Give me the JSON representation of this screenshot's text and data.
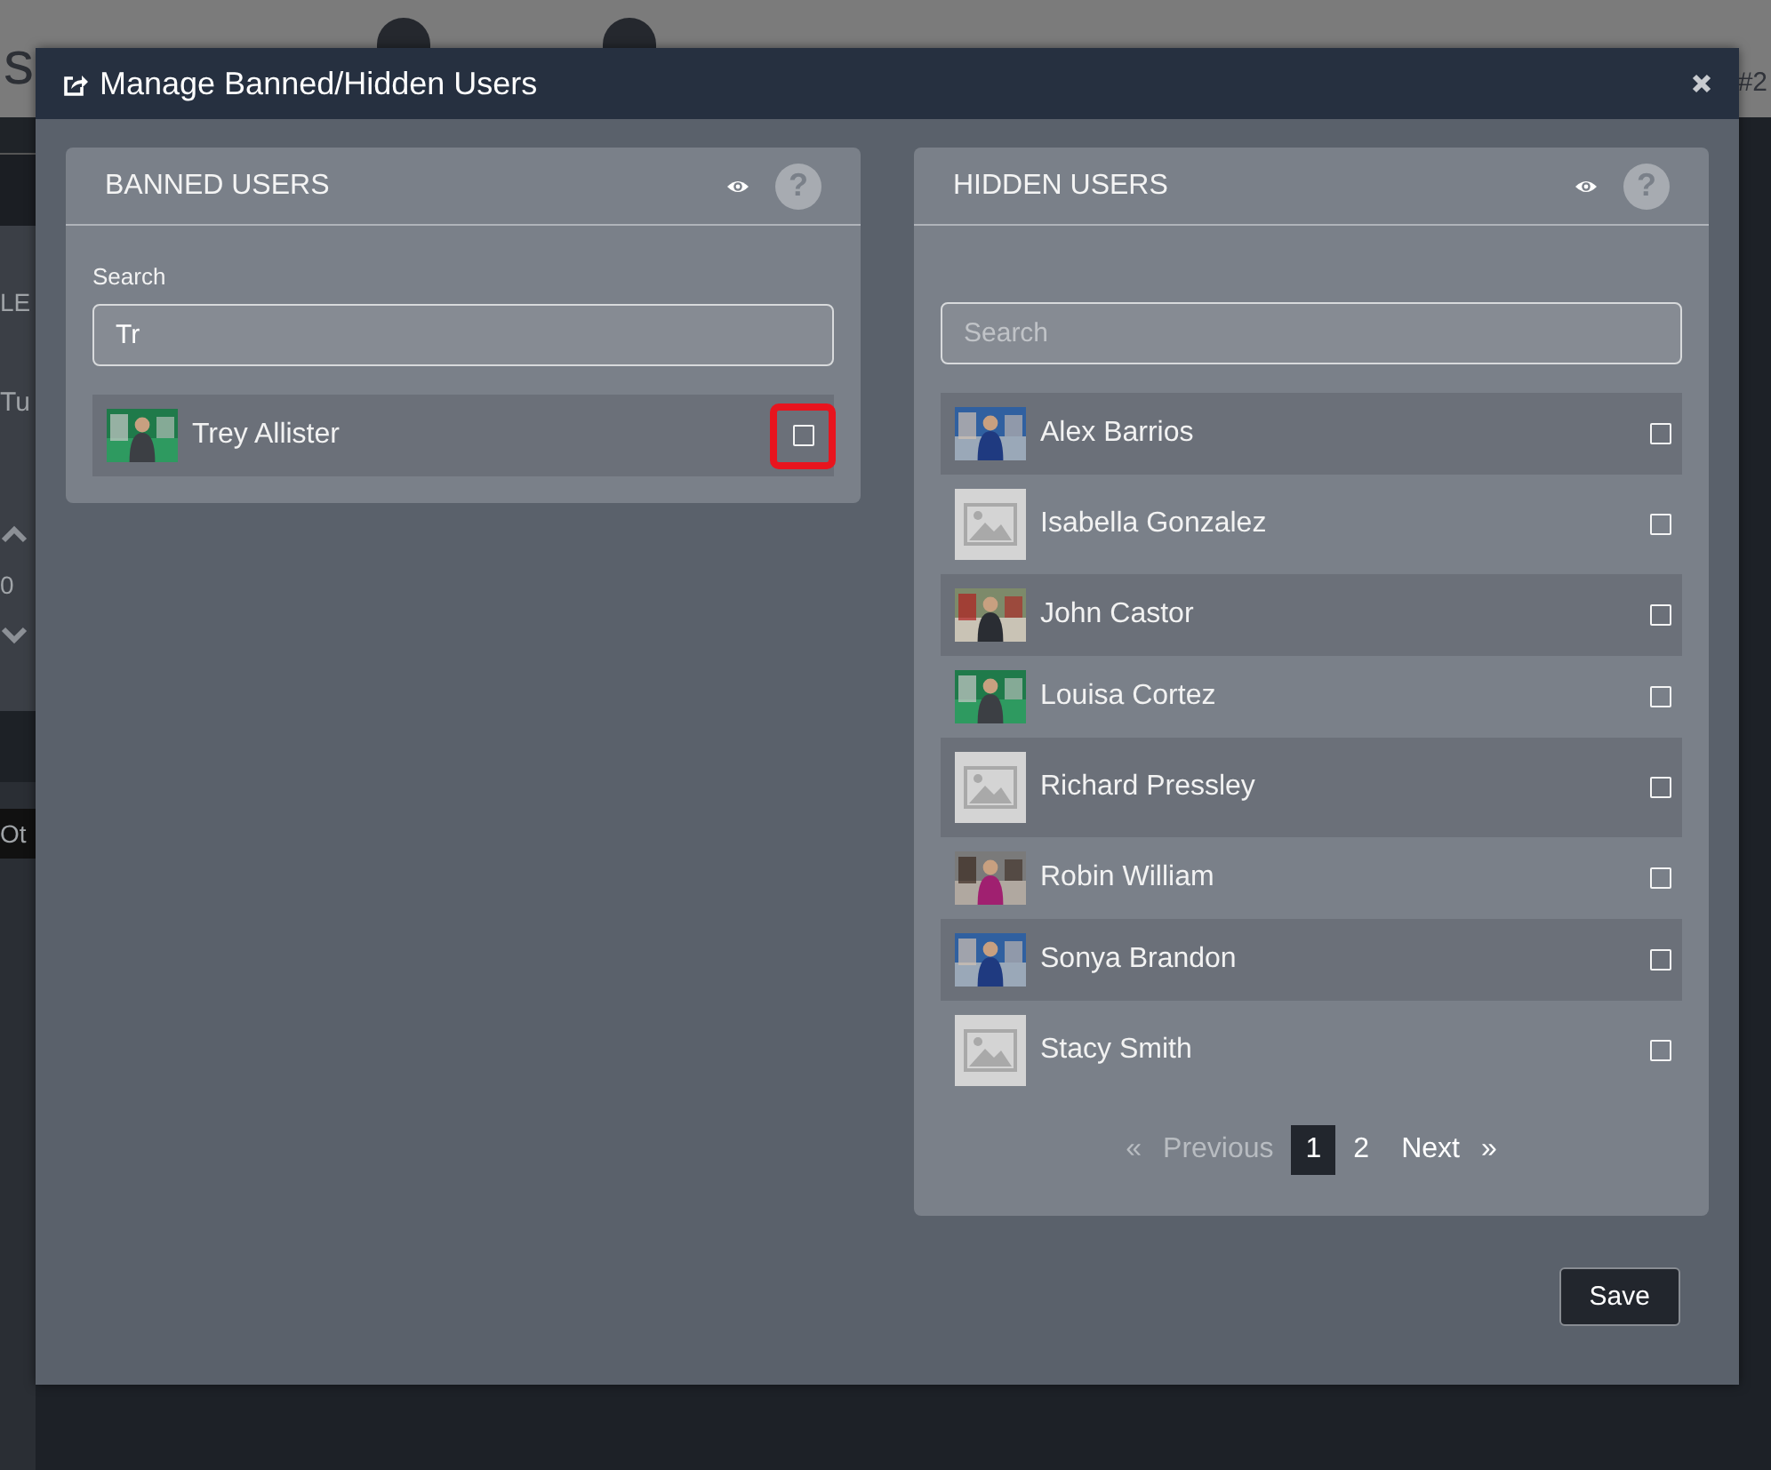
{
  "background_page": {
    "header_text": "s",
    "badge": "#2",
    "column_label": "LE",
    "avatar_initials": "Tu",
    "counter_value": "0",
    "tab_label": "Ot"
  },
  "dialog": {
    "title": "Manage Banned/Hidden Users",
    "panels": [
      {
        "title": "BANNED USERS",
        "help": "?",
        "search_label": "Search",
        "search_value": "Tr",
        "users": [
          {
            "name": "Trey Allister",
            "has_photo": true,
            "checked": false,
            "highlighted": true
          }
        ]
      },
      {
        "title": "HIDDEN USERS",
        "help": "?",
        "search_placeholder": "Search",
        "users": [
          {
            "name": "Alex Barrios",
            "has_photo": true,
            "checked": false,
            "highlighted": false
          },
          {
            "name": "Isabella Gonzalez",
            "has_photo": false,
            "checked": false,
            "highlighted": false
          },
          {
            "name": "John Castor",
            "has_photo": true,
            "checked": false,
            "highlighted": false
          },
          {
            "name": "Louisa Cortez",
            "has_photo": true,
            "checked": false,
            "highlighted": false
          },
          {
            "name": "Richard Pressley",
            "has_photo": false,
            "checked": false,
            "highlighted": false
          },
          {
            "name": "Robin William",
            "has_photo": true,
            "checked": false,
            "highlighted": false
          },
          {
            "name": "Sonya Brandon",
            "has_photo": true,
            "checked": false,
            "highlighted": false
          },
          {
            "name": "Stacy Smith",
            "has_photo": false,
            "checked": false,
            "highlighted": false
          }
        ],
        "pagination": {
          "previous": {
            "arrow": "«",
            "label": "Previous",
            "disabled": true
          },
          "pages": [
            {
              "label": "1",
              "selected": true
            },
            {
              "label": "2",
              "selected": false
            }
          ],
          "next": {
            "label": "Next",
            "arrow": "»",
            "disabled": false
          }
        }
      }
    ],
    "save_button": "Save"
  }
}
